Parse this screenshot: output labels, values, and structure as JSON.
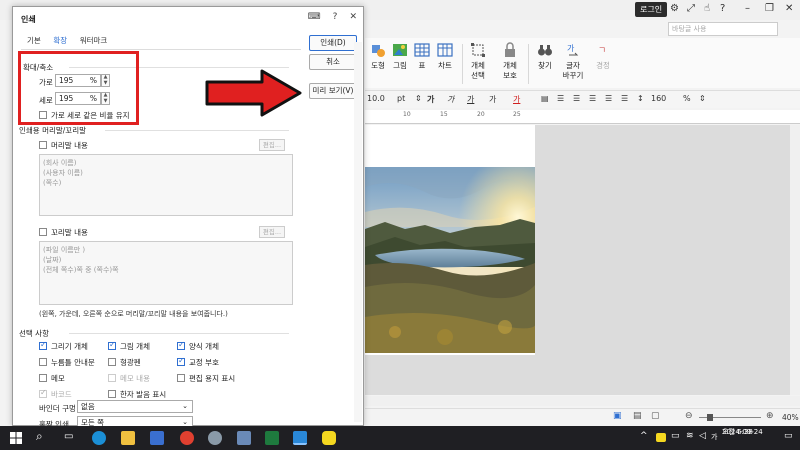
{
  "titlebar": {
    "login_label": "로그인",
    "style_box": "바탕글 사용"
  },
  "ribbon": {
    "items": [
      {
        "label": "도형"
      },
      {
        "label": "그림"
      },
      {
        "label": "표"
      },
      {
        "label": "차트"
      },
      {
        "label": "개체\n선택"
      },
      {
        "label": "개체\n보호"
      },
      {
        "label": "찾기"
      },
      {
        "label": "글자\n바꾸기"
      },
      {
        "label": "경정"
      }
    ]
  },
  "format_bar": {
    "font_size": "10.0",
    "font_unit": "pt",
    "line_spacing": "160",
    "line_unit": "%"
  },
  "ruler": {
    "marks": [
      "10",
      "15",
      "20",
      "25"
    ]
  },
  "statusbar": {
    "zoom": "40%"
  },
  "dialog": {
    "title": "인쇄",
    "tabs": [
      {
        "label": "기본",
        "active": false
      },
      {
        "label": "확장",
        "active": true
      },
      {
        "label": "워터마크",
        "active": false
      }
    ],
    "scale": {
      "section": "확대/축소",
      "width_label": "가로",
      "width_value": "195",
      "height_label": "세로",
      "height_value": "195",
      "unit": "%",
      "keep_ratio_label": "가로 세로 같은 비율 유지"
    },
    "header_footer": {
      "section": "인쇄용 머리말/꼬리말",
      "header_label": "머리말 내용",
      "header_lines": [
        "(회사 이름)",
        "(사용자 이름)",
        "(쪽수)"
      ],
      "footer_label": "꼬리말 내용",
      "footer_lines": [
        "(파일 이름만 )",
        "(날짜)",
        "(전체 쪽수)쪽 중 (쪽수)쪽"
      ],
      "edit_label": "편집...",
      "note": "(왼쪽, 가운데, 오른쪽 순으로 머리말/꼬리말 내용을 보여줍니다.)"
    },
    "options": {
      "section": "선택 사항",
      "items": [
        {
          "label": "그리기 개체",
          "checked": true,
          "disabled": false
        },
        {
          "label": "그림 개체",
          "checked": true,
          "disabled": false
        },
        {
          "label": "양식 개체",
          "checked": true,
          "disabled": false
        },
        {
          "label": "누름틀 안내문",
          "checked": false,
          "disabled": false
        },
        {
          "label": "형광펜",
          "checked": false,
          "disabled": false
        },
        {
          "label": "교정 부호",
          "checked": true,
          "disabled": false
        },
        {
          "label": "메모",
          "checked": false,
          "disabled": false
        },
        {
          "label": "메모 내용",
          "checked": false,
          "disabled": true
        },
        {
          "label": "편집 용지 표시",
          "checked": false,
          "disabled": false
        },
        {
          "label": "바코드",
          "checked": true,
          "disabled": true
        },
        {
          "label": "한자 발음 표시",
          "checked": false,
          "disabled": false
        }
      ]
    },
    "binder": {
      "label": "바인더 구멍",
      "value": "없음"
    },
    "duplex": {
      "label": "홀짝 인쇄",
      "value": "모든 쪽"
    },
    "buttons": {
      "print": "인쇄(D)",
      "cancel": "취소",
      "preview": "미리 보기(V)"
    }
  },
  "taskbar": {
    "time": "오전 6:38",
    "date": "2024-09-24",
    "ime": "가"
  },
  "colors": {
    "annotation_red": "#e02020",
    "accent_blue": "#2f6fd1",
    "taskbar": "#1f1f23"
  }
}
